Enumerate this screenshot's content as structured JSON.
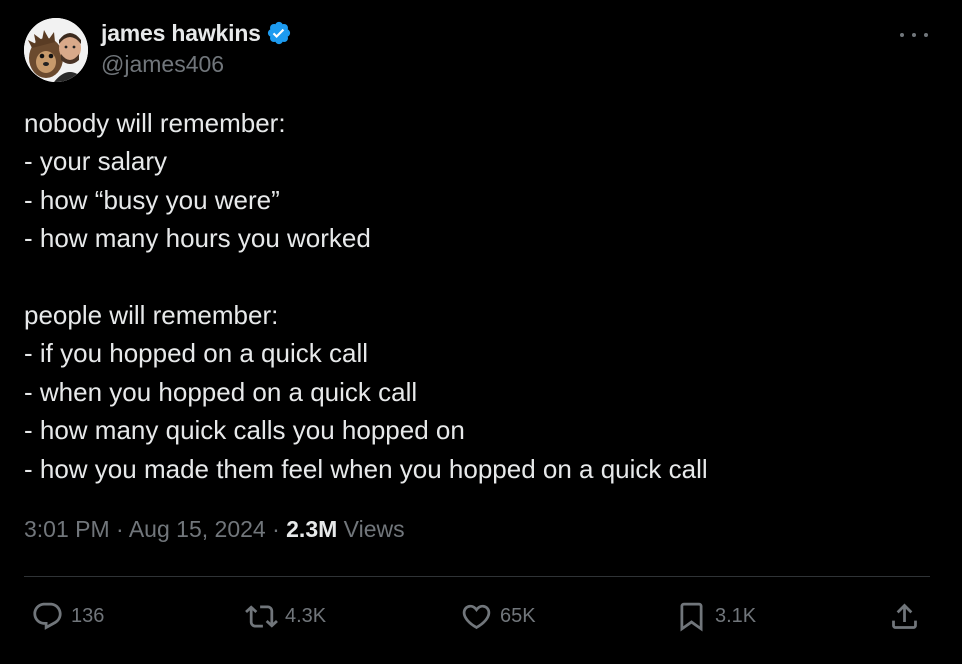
{
  "author": {
    "display_name": "james hawkins",
    "handle": "@james406",
    "verified": true,
    "verified_color": "#1d9bf0"
  },
  "menu": {
    "icon": "more-horizontal-icon"
  },
  "tweet": {
    "lines": [
      "nobody will remember:",
      "- your salary",
      "- how “busy you were”",
      "- how many hours you worked",
      "",
      "people will remember:",
      "- if you hopped on a quick call",
      "- when you hopped on a quick call",
      "- how many quick calls you hopped on",
      "- how you made them feel when you hopped on a quick call"
    ]
  },
  "meta": {
    "time": "3:01 PM",
    "separator": "·",
    "date": "Aug 15, 2024",
    "views_count": "2.3M",
    "views_label": "Views"
  },
  "actions": {
    "replies": {
      "icon": "reply-icon",
      "count": "136"
    },
    "reposts": {
      "icon": "repost-icon",
      "count": "4.3K"
    },
    "likes": {
      "icon": "like-icon",
      "count": "65K"
    },
    "bookmarks": {
      "icon": "bookmark-icon",
      "count": "3.1K"
    },
    "share": {
      "icon": "share-icon"
    }
  }
}
